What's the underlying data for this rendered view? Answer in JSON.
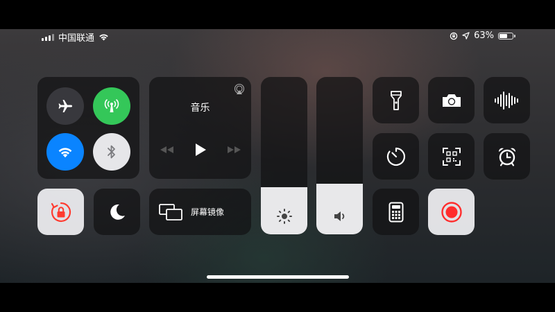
{
  "status_bar": {
    "carrier": "中国联通",
    "battery_percent": "63%",
    "battery_level": 0.63
  },
  "control_center": {
    "music": {
      "title": "音乐"
    },
    "screen_mirroring": {
      "label": "屏幕镜像"
    },
    "brightness_level": 0.3,
    "volume_level": 0.32
  },
  "colors": {
    "cellular_active": "#34c759",
    "wifi_active": "#0a84ff",
    "record_red": "#ff2d2d",
    "rotation_lock_red": "#ff3b30"
  },
  "icons": [
    "airplane-icon",
    "cellular-icon",
    "wifi-icon",
    "bluetooth-icon",
    "airplay-icon",
    "rewind-icon",
    "play-icon",
    "fast-forward-icon",
    "rotation-lock-icon",
    "moon-icon",
    "screen-mirror-icon",
    "sun-icon",
    "speaker-icon",
    "flashlight-icon",
    "camera-icon",
    "voice-memo-icon",
    "timer-icon",
    "qr-scanner-icon",
    "alarm-icon",
    "calculator-icon",
    "screen-record-icon",
    "location-icon",
    "wifi-status-icon",
    "signal-icon",
    "battery-icon"
  ]
}
